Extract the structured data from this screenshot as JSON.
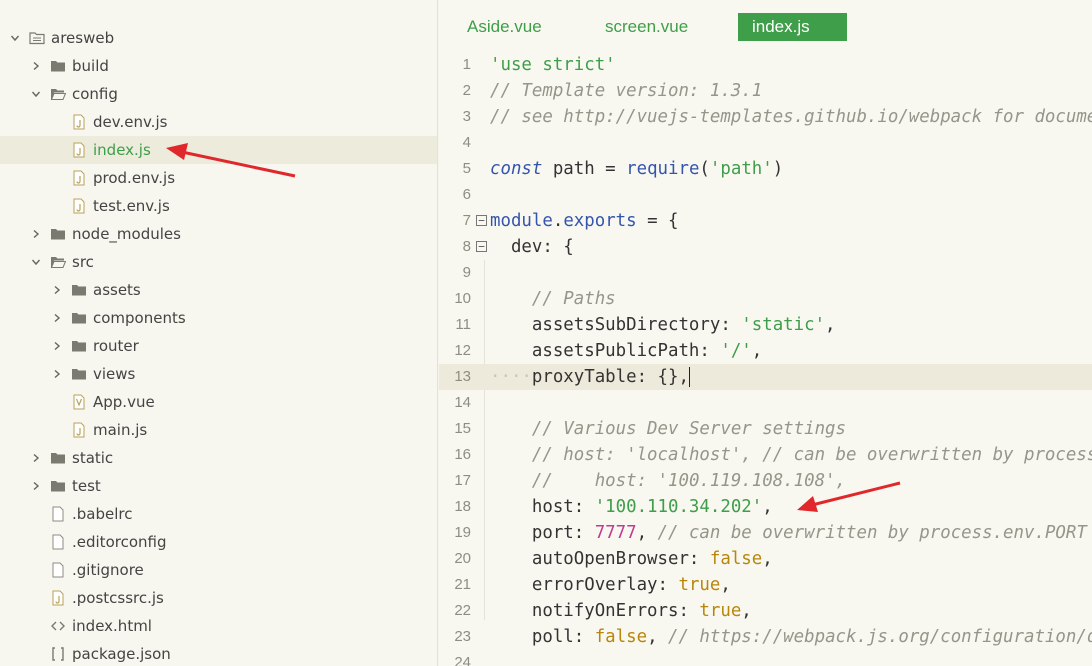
{
  "tree": [
    {
      "label": "aresweb",
      "depth": 0,
      "chevron": "down",
      "icon": "project-icon"
    },
    {
      "label": "build",
      "depth": 1,
      "chevron": "right",
      "icon": "folder-icon"
    },
    {
      "label": "config",
      "depth": 1,
      "chevron": "down",
      "icon": "folder-open-icon"
    },
    {
      "label": "dev.env.js",
      "depth": 2,
      "chevron": "none",
      "icon": "js-file-icon"
    },
    {
      "label": "index.js",
      "depth": 2,
      "chevron": "none",
      "icon": "js-file-icon",
      "selected": true
    },
    {
      "label": "prod.env.js",
      "depth": 2,
      "chevron": "none",
      "icon": "js-file-icon"
    },
    {
      "label": "test.env.js",
      "depth": 2,
      "chevron": "none",
      "icon": "js-file-icon"
    },
    {
      "label": "node_modules",
      "depth": 1,
      "chevron": "right",
      "icon": "folder-icon"
    },
    {
      "label": "src",
      "depth": 1,
      "chevron": "down",
      "icon": "folder-open-icon"
    },
    {
      "label": "assets",
      "depth": 2,
      "chevron": "right",
      "icon": "folder-icon"
    },
    {
      "label": "components",
      "depth": 2,
      "chevron": "right",
      "icon": "folder-icon"
    },
    {
      "label": "router",
      "depth": 2,
      "chevron": "right",
      "icon": "folder-icon"
    },
    {
      "label": "views",
      "depth": 2,
      "chevron": "right",
      "icon": "folder-icon"
    },
    {
      "label": "App.vue",
      "depth": 2,
      "chevron": "none",
      "icon": "vue-file-icon"
    },
    {
      "label": "main.js",
      "depth": 2,
      "chevron": "none",
      "icon": "js-file-icon"
    },
    {
      "label": "static",
      "depth": 1,
      "chevron": "right",
      "icon": "folder-icon"
    },
    {
      "label": "test",
      "depth": 1,
      "chevron": "right",
      "icon": "folder-icon"
    },
    {
      "label": ".babelrc",
      "depth": 1,
      "chevron": "none",
      "icon": "file-icon"
    },
    {
      "label": ".editorconfig",
      "depth": 1,
      "chevron": "none",
      "icon": "file-icon"
    },
    {
      "label": ".gitignore",
      "depth": 1,
      "chevron": "none",
      "icon": "file-icon"
    },
    {
      "label": ".postcssrc.js",
      "depth": 1,
      "chevron": "none",
      "icon": "js-file-icon"
    },
    {
      "label": "index.html",
      "depth": 1,
      "chevron": "none",
      "icon": "html-file-icon"
    },
    {
      "label": "package.json",
      "depth": 1,
      "chevron": "none",
      "icon": "json-file-icon"
    }
  ],
  "tabs": [
    {
      "label": "Aside.vue",
      "active": false
    },
    {
      "label": "screen.vue",
      "active": false
    },
    {
      "label": "index.js",
      "active": true
    }
  ],
  "code": [
    {
      "n": "1",
      "tokens": [
        [
          "s",
          "'use strict'"
        ]
      ]
    },
    {
      "n": "2",
      "tokens": [
        [
          "c",
          "// Template version: 1.3.1"
        ]
      ]
    },
    {
      "n": "3",
      "tokens": [
        [
          "c",
          "// see http://vuejs-templates.github.io/webpack for documentation."
        ]
      ]
    },
    {
      "n": "4",
      "tokens": []
    },
    {
      "n": "5",
      "tokens": [
        [
          "k",
          "const"
        ],
        [
          "p",
          " path = "
        ],
        [
          "f",
          "require"
        ],
        [
          "p",
          "("
        ],
        [
          "s",
          "'path'"
        ],
        [
          "p",
          ")"
        ]
      ]
    },
    {
      "n": "6",
      "tokens": []
    },
    {
      "n": "7",
      "fold": "minus",
      "tokens": [
        [
          "f",
          "module"
        ],
        [
          "p",
          "."
        ],
        [
          "f",
          "exports"
        ],
        [
          "p",
          " = {"
        ]
      ]
    },
    {
      "n": "8",
      "fold": "minus",
      "tokens": [
        [
          "p",
          "  dev: {"
        ]
      ]
    },
    {
      "n": "9",
      "tokens": []
    },
    {
      "n": "10",
      "tokens": [
        [
          "p",
          "    "
        ],
        [
          "c",
          "// Paths"
        ]
      ]
    },
    {
      "n": "11",
      "tokens": [
        [
          "p",
          "    assetsSubDirectory: "
        ],
        [
          "s",
          "'static'"
        ],
        [
          "p",
          ","
        ]
      ]
    },
    {
      "n": "12",
      "tokens": [
        [
          "p",
          "    assetsPublicPath: "
        ],
        [
          "s",
          "'/'"
        ],
        [
          "p",
          ","
        ]
      ]
    },
    {
      "n": "13",
      "current": true,
      "tokens": [
        [
          "ws",
          "····"
        ],
        [
          "p",
          "proxyTable: {},"
        ],
        [
          "cursor",
          ""
        ]
      ]
    },
    {
      "n": "14",
      "tokens": []
    },
    {
      "n": "15",
      "tokens": [
        [
          "p",
          "    "
        ],
        [
          "c",
          "// Various Dev Server settings"
        ]
      ]
    },
    {
      "n": "16",
      "tokens": [
        [
          "p",
          "    "
        ],
        [
          "c",
          "// host: 'localhost', // can be overwritten by process.env.HOST"
        ]
      ]
    },
    {
      "n": "17",
      "tokens": [
        [
          "p",
          "    "
        ],
        [
          "c",
          "//    host: '100.119.108.108',"
        ]
      ]
    },
    {
      "n": "18",
      "tokens": [
        [
          "p",
          "    host: "
        ],
        [
          "s",
          "'100.110.34.202'"
        ],
        [
          "p",
          ","
        ]
      ]
    },
    {
      "n": "19",
      "tokens": [
        [
          "p",
          "    port: "
        ],
        [
          "n",
          "7777"
        ],
        [
          "p",
          ", "
        ],
        [
          "c",
          "// can be overwritten by process.env.PORT"
        ]
      ]
    },
    {
      "n": "20",
      "tokens": [
        [
          "p",
          "    autoOpenBrowser: "
        ],
        [
          "b",
          "false"
        ],
        [
          "p",
          ","
        ]
      ]
    },
    {
      "n": "21",
      "tokens": [
        [
          "p",
          "    errorOverlay: "
        ],
        [
          "b",
          "true"
        ],
        [
          "p",
          ","
        ]
      ]
    },
    {
      "n": "22",
      "tokens": [
        [
          "p",
          "    notifyOnErrors: "
        ],
        [
          "b",
          "true"
        ],
        [
          "p",
          ","
        ]
      ]
    },
    {
      "n": "23",
      "tokens": [
        [
          "p",
          "    poll: "
        ],
        [
          "b",
          "false"
        ],
        [
          "p",
          ", "
        ],
        [
          "c",
          "// https://webpack.js.org/configuration/dev-server/"
        ]
      ]
    },
    {
      "n": "24",
      "tokens": []
    }
  ],
  "colors": {
    "accent": "#3e9e49",
    "arrow": "#e0282c",
    "keyword": "#3555ad",
    "number": "#c23a8f",
    "boolean": "#b8860b",
    "comment": "#959589"
  }
}
